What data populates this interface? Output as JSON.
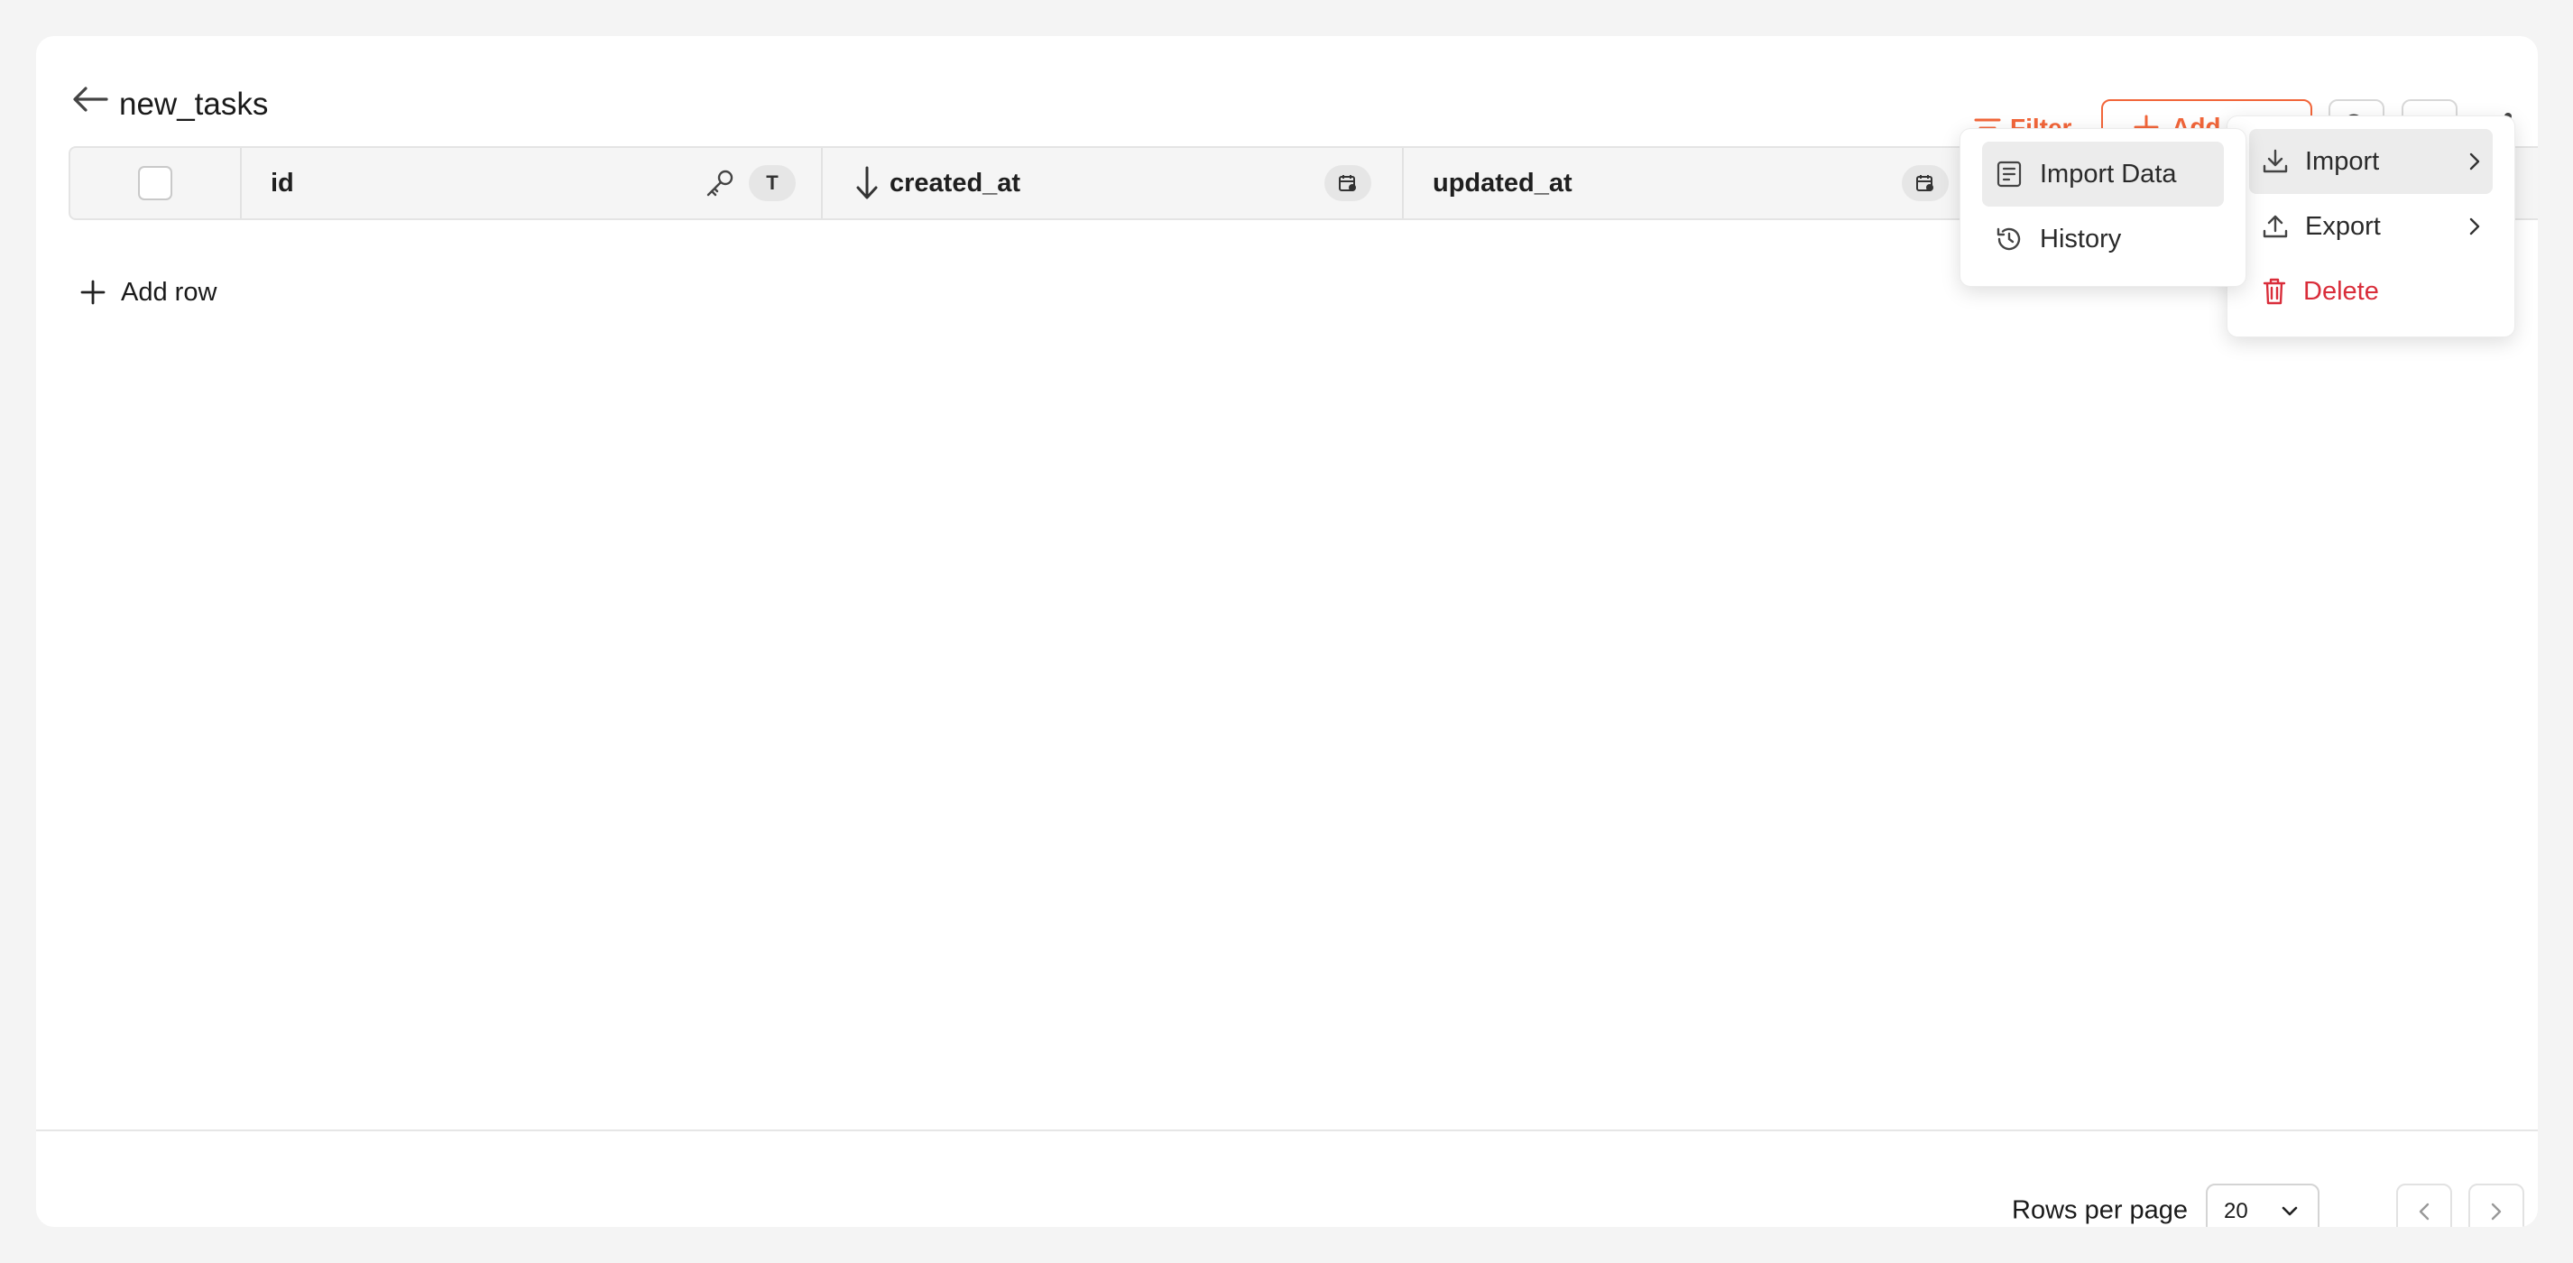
{
  "header": {
    "title": "new_tasks",
    "filter_label": "Filter",
    "add_data_label": "Add data"
  },
  "table": {
    "columns": [
      {
        "name": "id",
        "type_badge": "T",
        "has_key_icon": true
      },
      {
        "name": "created_at",
        "sort": "descending",
        "type_icon": "calendar-icon"
      },
      {
        "name": "updated_at",
        "type_icon": "calendar-icon"
      }
    ],
    "add_row_label": "Add row"
  },
  "more_menu": {
    "items": [
      {
        "label": "Import",
        "icon": "download-icon",
        "has_submenu": true,
        "active": true
      },
      {
        "label": "Export",
        "icon": "upload-icon",
        "has_submenu": true
      },
      {
        "label": "Delete",
        "icon": "trash-icon",
        "danger": true
      }
    ]
  },
  "import_submenu": {
    "items": [
      {
        "label": "Import Data",
        "icon": "import-data-icon",
        "active": true
      },
      {
        "label": "History",
        "icon": "history-icon"
      }
    ]
  },
  "footer": {
    "rows_per_page_label": "Rows per page",
    "rows_per_page_value": "20"
  },
  "colors": {
    "accent": "#f2663a",
    "danger": "#d92d3a"
  }
}
